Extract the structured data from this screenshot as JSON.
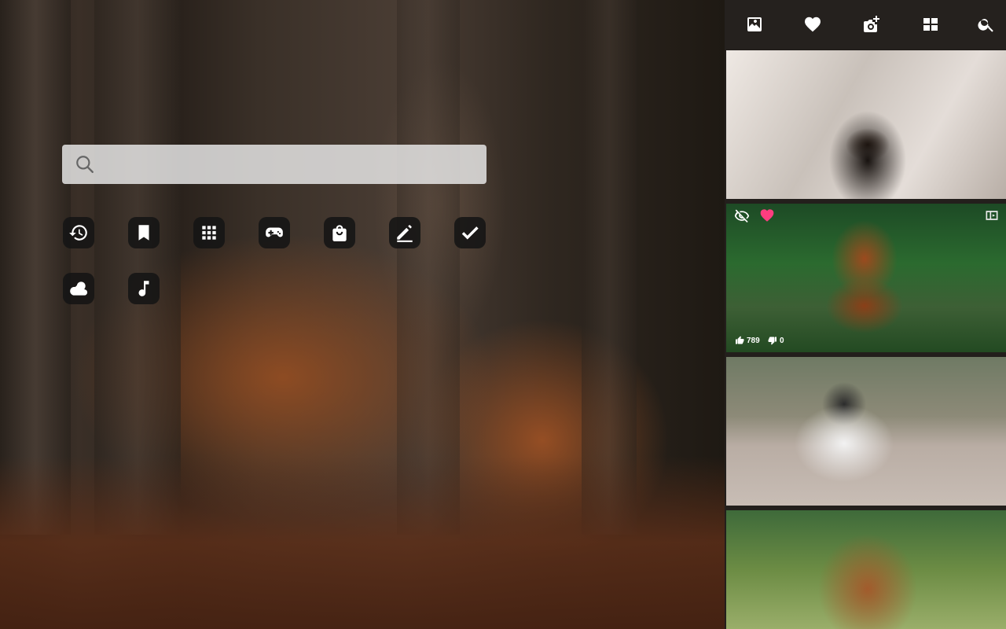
{
  "search": {
    "placeholder": ""
  },
  "shortcuts": [
    {
      "name": "history-icon"
    },
    {
      "name": "bookmark-icon"
    },
    {
      "name": "apps-grid-icon"
    },
    {
      "name": "gamepad-icon"
    },
    {
      "name": "shopping-bag-icon"
    },
    {
      "name": "edit-pencil-icon"
    },
    {
      "name": "checkmark-icon"
    },
    {
      "name": "weather-icon"
    },
    {
      "name": "music-note-icon"
    }
  ],
  "toolbar": [
    {
      "name": "wallpaper-icon"
    },
    {
      "name": "favorite-heart-icon"
    },
    {
      "name": "add-photo-icon"
    },
    {
      "name": "gallery-grid-icon"
    },
    {
      "name": "search-icon"
    }
  ],
  "gallery": {
    "hovered_item": {
      "likes": "789",
      "dislikes": "0"
    }
  },
  "colors": {
    "panel_background": "#231f1c",
    "favorite_active": "#ff3d7f",
    "search_bar": "#ebebeb"
  }
}
